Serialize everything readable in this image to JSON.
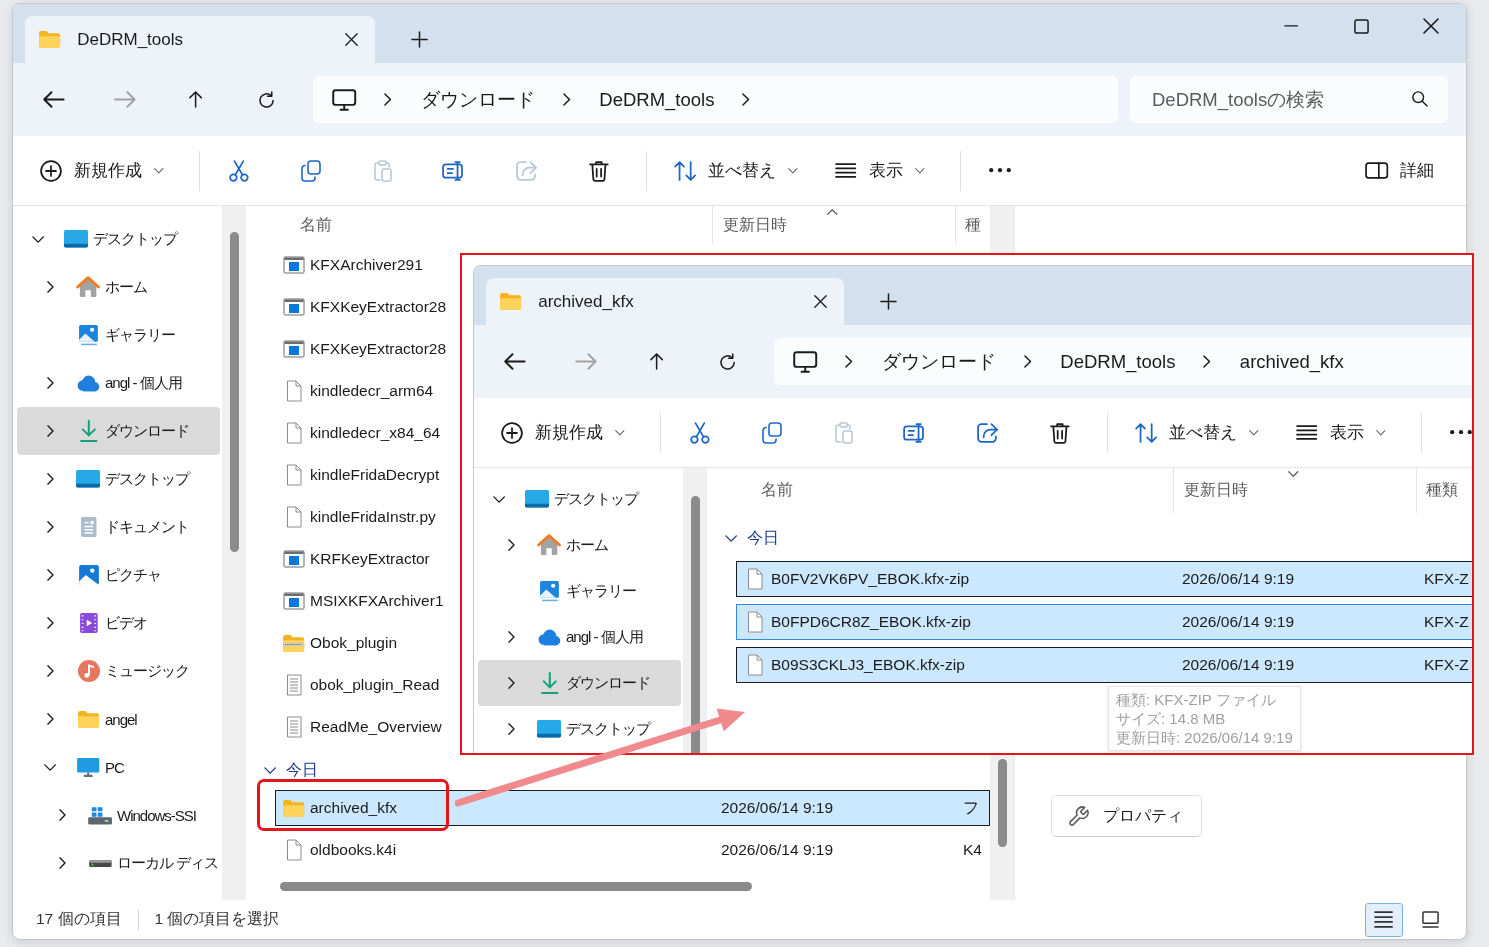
{
  "window": {
    "tabs": [
      {
        "title": "DeDRM_tools",
        "selected": true
      }
    ],
    "nav_buttons": [
      {
        "kind": "back",
        "disabled": false
      },
      {
        "kind": "forward",
        "disabled": true
      },
      {
        "kind": "up",
        "disabled": false
      },
      {
        "kind": "refresh",
        "disabled": false
      }
    ],
    "address": {
      "segments": [
        "ダウンロード",
        "DeDRM_tools"
      ],
      "trailing_chevron": true
    },
    "search": {
      "placeholder": "DeDRM_toolsの検索"
    },
    "toolbar": [
      {
        "items": [
          {
            "kind": "new",
            "label": "新規作成",
            "disabled": false
          }
        ]
      },
      {
        "items": [
          {
            "kind": "cut",
            "disabled": false
          },
          {
            "kind": "copy",
            "disabled": false
          },
          {
            "kind": "paste",
            "disabled": true
          },
          {
            "kind": "rename",
            "disabled": false
          },
          {
            "kind": "share",
            "disabled": true
          },
          {
            "kind": "delete",
            "disabled": false
          }
        ]
      },
      {
        "items": [
          {
            "kind": "sort",
            "label": "並べ替え",
            "disabled": false
          },
          {
            "kind": "view",
            "label": "表示",
            "disabled": false
          }
        ]
      },
      {
        "items": [
          {
            "kind": "more",
            "disabled": false
          }
        ]
      }
    ],
    "details_toggle": {
      "label": "詳細"
    },
    "sidebar": [
      {
        "label": "デスクトップ",
        "kind": "desktop",
        "expanded": true,
        "selected": false,
        "children": [
          {
            "label": "ホーム",
            "kind": "home",
            "expanded": false,
            "selected": false
          },
          {
            "label": "ギャラリー",
            "kind": "gallery",
            "selected": false
          },
          {
            "label": "angl - 個人用",
            "kind": "cloud",
            "expanded": false,
            "selected": false
          },
          {
            "label": "ダウンロード",
            "kind": "download",
            "expanded": false,
            "selected": true
          },
          {
            "label": "デスクトップ",
            "kind": "desktop",
            "expanded": false,
            "selected": false
          },
          {
            "label": "ドキュメント",
            "kind": "documents",
            "expanded": false,
            "selected": false
          },
          {
            "label": "ピクチャ",
            "kind": "pictures",
            "expanded": false,
            "selected": false
          },
          {
            "label": "ビデオ",
            "kind": "videos",
            "expanded": false,
            "selected": false
          },
          {
            "label": "ミュージック",
            "kind": "music",
            "expanded": false,
            "selected": false
          },
          {
            "label": "angel",
            "kind": "folder",
            "expanded": false,
            "selected": false
          },
          {
            "label": "PC",
            "kind": "pc",
            "expanded": true,
            "selected": false,
            "children": [
              {
                "label": "Windows-SSI",
                "kind": "sysdisk",
                "expanded": false,
                "selected": false
              },
              {
                "label": "ローカル ディス",
                "kind": "disk",
                "expanded": false,
                "selected": false
              }
            ]
          }
        ]
      }
    ],
    "columns": [
      {
        "label": "名前",
        "sorted": false
      },
      {
        "label": "更新日時",
        "sorted": true,
        "ascending": true
      },
      {
        "label": "種",
        "sorted": false
      }
    ],
    "groups": [
      {
        "rows": [
          {
            "name": "KFXArchiver291",
            "kind": "app",
            "selected": false,
            "hovered": false
          },
          {
            "name": "KFXKeyExtractor28",
            "kind": "app",
            "selected": false,
            "hovered": false
          },
          {
            "name": "KFXKeyExtractor28",
            "kind": "app",
            "selected": false,
            "hovered": false
          },
          {
            "name": "kindledecr_arm64",
            "kind": "file",
            "selected": false,
            "hovered": false
          },
          {
            "name": "kindledecr_x84_64",
            "kind": "file",
            "selected": false,
            "hovered": false
          },
          {
            "name": "kindleFridaDecrypt",
            "kind": "file",
            "selected": false,
            "hovered": false
          },
          {
            "name": "kindleFridaInstr.py",
            "kind": "file",
            "selected": false,
            "hovered": false
          },
          {
            "name": "KRFKeyExtractor",
            "kind": "app",
            "selected": false,
            "hovered": false
          },
          {
            "name": "MSIXKFXArchiver1",
            "kind": "app",
            "selected": false,
            "hovered": false
          },
          {
            "name": "Obok_plugin",
            "kind": "zip",
            "selected": false,
            "hovered": false
          },
          {
            "name": "obok_plugin_Read",
            "kind": "text",
            "selected": false,
            "hovered": false
          },
          {
            "name": "ReadMe_Overview",
            "kind": "text",
            "selected": false,
            "hovered": false
          }
        ]
      },
      {
        "label": "今日",
        "expanded": true,
        "rows": [
          {
            "name": "archived_kfx",
            "kind": "folder",
            "date": "2026/06/14 9:19",
            "type": "フ",
            "selected": true,
            "hovered": false
          },
          {
            "name": "oldbooks.k4i",
            "kind": "file",
            "date": "2026/06/14 9:19",
            "type": "K4",
            "selected": false,
            "hovered": false
          }
        ]
      }
    ],
    "details_pane": {
      "button": "プロパティ"
    },
    "status_bar": {
      "item_count": "17 個の項目",
      "selection": "1 個の項目を選択",
      "views": [
        {
          "kind": "details",
          "selected": true
        },
        {
          "kind": "tiles",
          "selected": false
        }
      ]
    }
  },
  "inset_window": {
    "tabs": [
      {
        "title": "archived_kfx",
        "selected": true
      }
    ],
    "nav_buttons": [
      {
        "kind": "back",
        "disabled": false
      },
      {
        "kind": "forward",
        "disabled": true
      },
      {
        "kind": "up",
        "disabled": false
      },
      {
        "kind": "refresh",
        "disabled": false
      }
    ],
    "address": {
      "segments": [
        "ダウンロード",
        "DeDRM_tools",
        "archived_kfx"
      ],
      "trailing_chevron": false
    },
    "toolbar": [
      {
        "items": [
          {
            "kind": "new",
            "label": "新規作成",
            "disabled": false
          }
        ]
      },
      {
        "items": [
          {
            "kind": "cut",
            "disabled": false
          },
          {
            "kind": "copy",
            "disabled": false
          },
          {
            "kind": "paste",
            "disabled": true
          },
          {
            "kind": "rename",
            "disabled": false
          },
          {
            "kind": "share",
            "disabled": false
          },
          {
            "kind": "delete",
            "disabled": false
          }
        ]
      },
      {
        "items": [
          {
            "kind": "sort",
            "label": "並べ替え",
            "disabled": false
          },
          {
            "kind": "view",
            "label": "表示",
            "disabled": false
          }
        ]
      },
      {
        "items": [
          {
            "kind": "more",
            "disabled": false
          }
        ]
      }
    ],
    "sidebar": [
      {
        "label": "デスクトップ",
        "kind": "desktop",
        "expanded": true,
        "selected": false,
        "children": [
          {
            "label": "ホーム",
            "kind": "home",
            "expanded": false,
            "selected": false
          },
          {
            "label": "ギャラリー",
            "kind": "gallery",
            "selected": false
          },
          {
            "label": "angl - 個人用",
            "kind": "cloud",
            "expanded": false,
            "selected": false
          },
          {
            "label": "ダウンロード",
            "kind": "download",
            "expanded": false,
            "selected": true
          },
          {
            "label": "デスクトップ",
            "kind": "desktop",
            "expanded": false,
            "selected": false
          }
        ]
      }
    ],
    "columns": [
      {
        "label": "名前",
        "sorted": false
      },
      {
        "label": "更新日時",
        "sorted": true,
        "ascending": false
      },
      {
        "label": "種類",
        "sorted": false
      }
    ],
    "groups": [
      {
        "label": "今日",
        "expanded": true,
        "rows": [
          {
            "name": "B0FV2VK6PV_EBOK.kfx-zip",
            "kind": "file",
            "date": "2026/06/14 9:19",
            "type": "KFX-Z",
            "selected": true,
            "hovered": false
          },
          {
            "name": "B0FPD6CR8Z_EBOK.kfx-zip",
            "kind": "file",
            "date": "2026/06/14 9:19",
            "type": "KFX-Z",
            "selected": true,
            "hovered": true
          },
          {
            "name": "B09S3CKLJ3_EBOK.kfx-zip",
            "kind": "file",
            "date": "2026/06/14 9:19",
            "type": "KFX-Z",
            "selected": true,
            "hovered": false
          }
        ]
      }
    ],
    "tooltip": [
      "種類: KFX-ZIP ファイル",
      "サイズ: 14.8 MB",
      "更新日時: 2026/06/14 9:19"
    ]
  }
}
